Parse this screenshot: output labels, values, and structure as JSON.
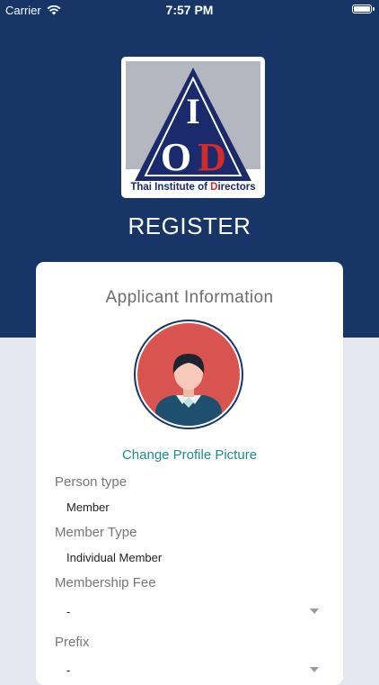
{
  "status_bar": {
    "carrier": "Carrier",
    "time": "7:57 PM"
  },
  "logo": {
    "letter_i": "I",
    "letter_o": "O",
    "letter_d": "D",
    "caption_start": "Thai Institute of ",
    "caption_highlight": "D",
    "caption_end": "irectors",
    "colors": {
      "navy": "#1a2a6c",
      "red": "#d32a2a",
      "gray": "#b4b7bf"
    }
  },
  "header": {
    "title": "REGISTER",
    "background": "#173566"
  },
  "form": {
    "title": "Applicant Information",
    "avatar_icon": "user-avatar-icon",
    "change_picture_label": "Change Profile Picture",
    "fields": [
      {
        "label": "Person type",
        "value": "Member"
      },
      {
        "label": "Member Type",
        "value": "Individual Member"
      },
      {
        "label": "Membership Fee",
        "value": "-"
      },
      {
        "label": "Prefix",
        "value": "-"
      }
    ],
    "accent_color": "#1f8c8a"
  }
}
